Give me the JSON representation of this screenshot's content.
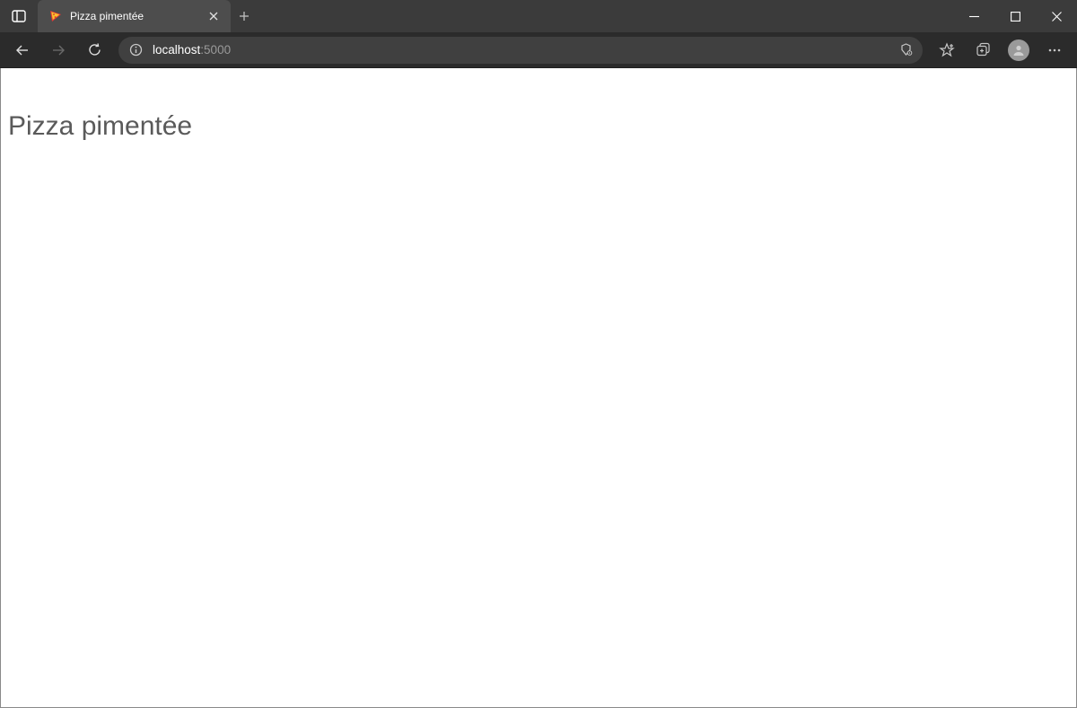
{
  "tab": {
    "title": "Pizza pimentée",
    "icon": "pizza-icon"
  },
  "addressBar": {
    "host": "localhost",
    "path": ":5000"
  },
  "page": {
    "heading": "Pizza pimentée"
  }
}
